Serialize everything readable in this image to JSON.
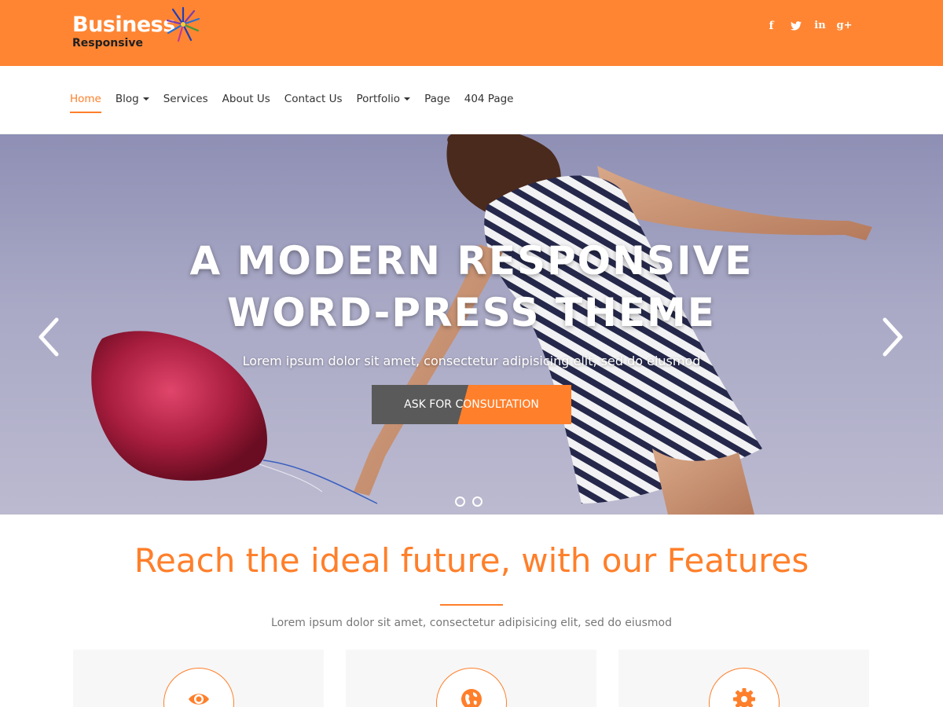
{
  "brand": {
    "name": "Business",
    "tagline": "Responsive",
    "accent": "#ff8533",
    "star_icon": "starburst-icon"
  },
  "social": [
    {
      "icon": "facebook-icon",
      "glyph": "f"
    },
    {
      "icon": "twitter-icon",
      "glyph": "t"
    },
    {
      "icon": "linkedin-icon",
      "glyph": "in"
    },
    {
      "icon": "googleplus-icon",
      "glyph": "g+"
    }
  ],
  "nav": {
    "items": [
      {
        "label": "Home",
        "active": true,
        "dropdown": false
      },
      {
        "label": "Blog",
        "active": false,
        "dropdown": true
      },
      {
        "label": "Services",
        "active": false,
        "dropdown": false
      },
      {
        "label": "About Us",
        "active": false,
        "dropdown": false
      },
      {
        "label": "Contact Us",
        "active": false,
        "dropdown": false
      },
      {
        "label": "Portfolio",
        "active": false,
        "dropdown": true
      },
      {
        "label": "Page",
        "active": false,
        "dropdown": false
      },
      {
        "label": "404 Page",
        "active": false,
        "dropdown": false
      }
    ]
  },
  "hero": {
    "title_line1": "A MODERN RESPONSIVE",
    "title_line2": "WORD-PRESS THEME",
    "subtitle": "Lorem ipsum dolor sit amet, consectetur adipisicing elit, sed do eiusmod",
    "cta_label": "ASK FOR CONSULTATION",
    "slide_count": 2,
    "prev_icon": "chevron-left-icon",
    "next_icon": "chevron-right-icon"
  },
  "features": {
    "title": "Reach the ideal future, with our Features",
    "subtitle": "Lorem ipsum dolor sit amet, consectetur adipisicing elit, sed do eiusmod",
    "cards": [
      {
        "icon": "eye-icon"
      },
      {
        "icon": "globe-icon"
      },
      {
        "icon": "gear-icon"
      }
    ]
  }
}
